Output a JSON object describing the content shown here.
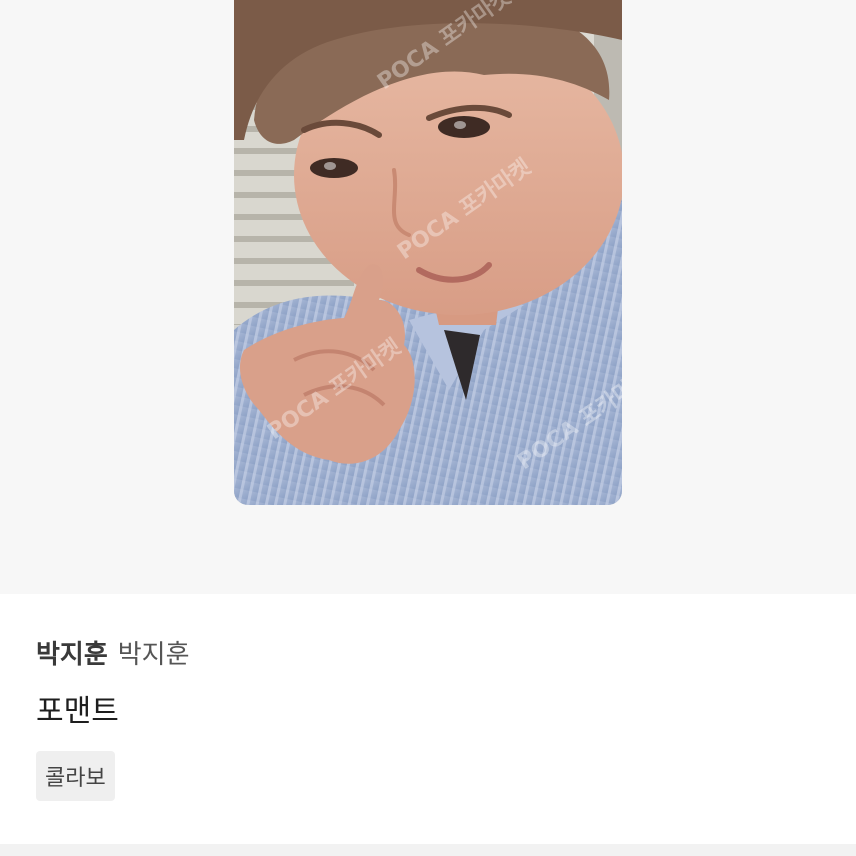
{
  "product": {
    "artist_group": "박지훈",
    "member": "박지훈",
    "title": "포맨트",
    "tag": "콜라보"
  },
  "photo": {
    "watermark": "POCA 포카마켓"
  },
  "colors": {
    "photo_area_bg": "#f7f7f7",
    "tag_bg": "#efefef",
    "text_primary": "#1e1e1e",
    "text_secondary": "#555555"
  }
}
